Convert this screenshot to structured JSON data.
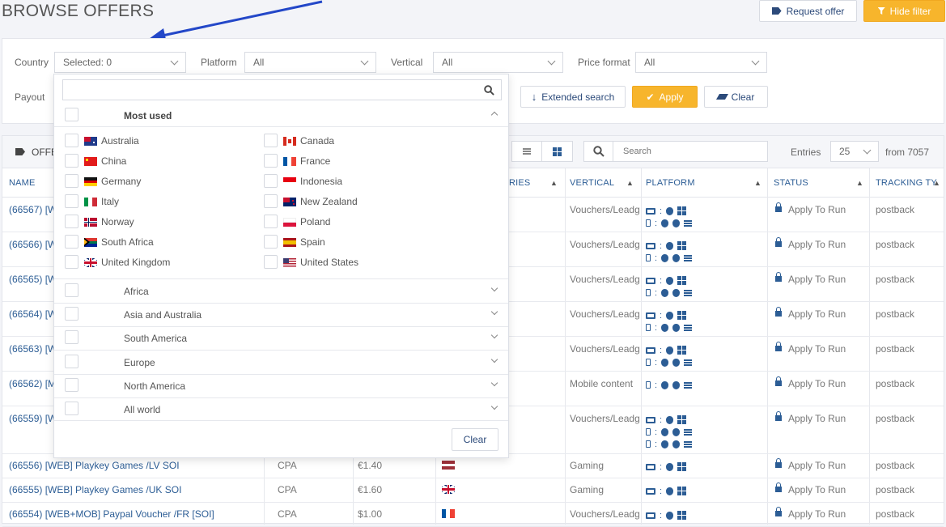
{
  "header": {
    "title": "BROWSE OFFERS",
    "request_offer": "Request offer",
    "hide_filter": "Hide filter"
  },
  "filters": {
    "country_label": "Country",
    "country_value": "Selected: 0",
    "platform_label": "Platform",
    "platform_value": "All",
    "vertical_label": "Vertical",
    "vertical_value": "All",
    "price_format_label": "Price format",
    "price_format_value": "All",
    "payout_label": "Payout",
    "extended_search": "Extended search",
    "apply": "Apply",
    "clear": "Clear"
  },
  "country_dropdown": {
    "search_placeholder": "",
    "most_used_label": "Most used",
    "countries_left": [
      "Australia",
      "China",
      "Germany",
      "Italy",
      "Norway",
      "South Africa",
      "United Kingdom"
    ],
    "countries_right": [
      "Canada",
      "France",
      "Indonesia",
      "New Zealand",
      "Poland",
      "Spain",
      "United States"
    ],
    "regions": [
      "Africa",
      "Asia and Australia",
      "South America",
      "Europe",
      "North America",
      "All world"
    ],
    "clear": "Clear"
  },
  "offers": {
    "tab_label": "OFFE",
    "search_placeholder": "Search",
    "entries_label": "Entries",
    "entries_value": "25",
    "from_text": "from 7057",
    "columns": {
      "name": "NAME",
      "countries": "RIES",
      "vertical": "VERTICAL",
      "platform": "PLATFORM",
      "status": "STATUS",
      "tracking": "TRACKING TY"
    },
    "rows": [
      {
        "name": "(66567) [W",
        "price_type": "",
        "payout": "",
        "flag": "",
        "vertical": "Vouchers/Leadge",
        "status": "Apply To Run",
        "tracking": "postback"
      },
      {
        "name": "(66566) [W",
        "price_type": "",
        "payout": "",
        "flag": "",
        "vertical": "Vouchers/Leadge",
        "status": "Apply To Run",
        "tracking": "postback"
      },
      {
        "name": "(66565) [W",
        "price_type": "",
        "payout": "",
        "flag": "",
        "vertical": "Vouchers/Leadge",
        "status": "Apply To Run",
        "tracking": "postback"
      },
      {
        "name": "(66564) [W",
        "price_type": "",
        "payout": "",
        "flag": "",
        "vertical": "Vouchers/Leadge",
        "status": "Apply To Run",
        "tracking": "postback"
      },
      {
        "name": "(66563) [W",
        "price_type": "",
        "payout": "",
        "flag": "",
        "vertical": "Vouchers/Leadge",
        "status": "Apply To Run",
        "tracking": "postback"
      },
      {
        "name": "(66562) [M",
        "price_type": "",
        "payout": "",
        "flag": "",
        "vertical": "Mobile content",
        "status": "Apply To Run",
        "tracking": "postback"
      },
      {
        "name": "(66559) [W",
        "price_type": "",
        "payout": "",
        "flag": "",
        "vertical": "Vouchers/Leadge",
        "status": "Apply To Run",
        "tracking": "postback"
      },
      {
        "name": "(66556) [WEB] Playkey Games /LV SOI",
        "price_type": "CPA",
        "payout": "€1.40",
        "flag": "latvia",
        "vertical": "Gaming",
        "status": "Apply To Run",
        "tracking": "postback"
      },
      {
        "name": "(66555) [WEB] Playkey Games /UK SOI",
        "price_type": "CPA",
        "payout": "€1.60",
        "flag": "uk",
        "vertical": "Gaming",
        "status": "Apply To Run",
        "tracking": "postback"
      },
      {
        "name": "(66554) [WEB+MOB] Paypal Voucher /FR [SOI]",
        "price_type": "CPA",
        "payout": "$1.00",
        "flag": "france",
        "vertical": "Vouchers/Leadge",
        "status": "Apply To Run",
        "tracking": "postback"
      }
    ]
  },
  "colors": {
    "accent_orange": "#f7b52c",
    "link_blue": "#2c5d95",
    "annotation_arrow": "#2347c8"
  }
}
